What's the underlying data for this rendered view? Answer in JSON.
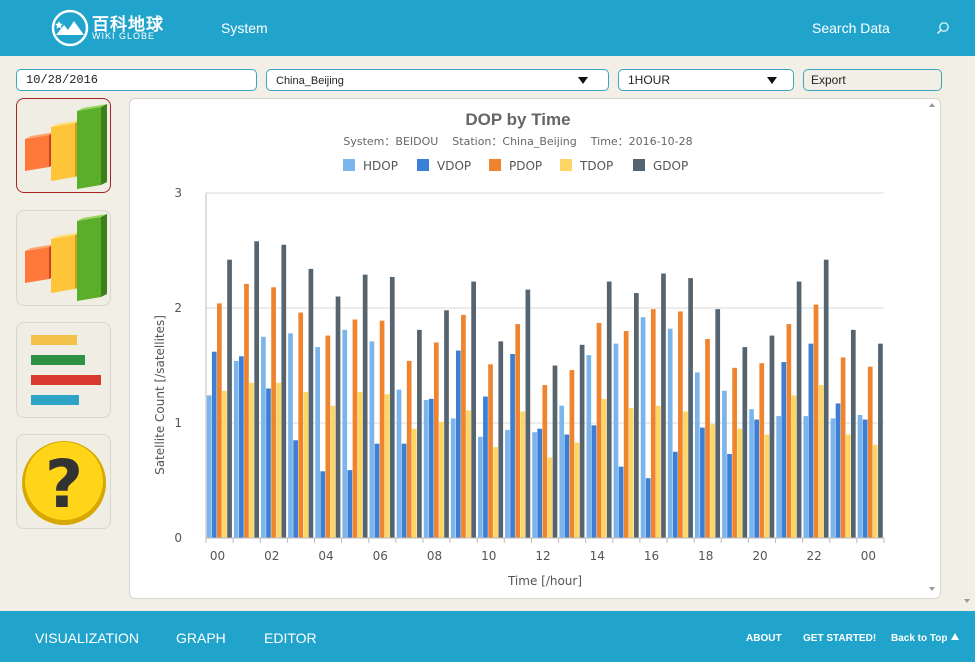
{
  "header": {
    "brand_cn": "百科地球",
    "brand_en": "WIKI GLOBE",
    "nav_system": "System",
    "search_label": "Search Data"
  },
  "controls": {
    "date_value": "10/28/2016",
    "station_value": "China_Beijing",
    "interval_value": "1HOUR",
    "export_label": "Export"
  },
  "footer": {
    "nav": [
      "VISUALIZATION",
      "GRAPH",
      "EDITOR"
    ],
    "about": "ABOUT",
    "get_started": "GET STARTED!",
    "back_to_top": "Back to Top"
  },
  "colors": {
    "header_bg": "#21a4cc",
    "HDOP": "#7cb5ec",
    "VDOP": "#3b7fd6",
    "PDOP": "#f0832e",
    "TDOP": "#fdd666",
    "GDOP": "#566470"
  },
  "chart_data": {
    "type": "bar",
    "title": "DOP by Time",
    "subtitle": "System：BEIDOU    Station：China_Beijing    Time：2016-10-28",
    "xlabel": "Time [/hour]",
    "ylabel": "Satellite Count [/satellites]",
    "ylim": [
      0,
      3
    ],
    "yticks": [
      "0",
      "1",
      "2",
      "3"
    ],
    "xticks": [
      "00",
      "02",
      "04",
      "06",
      "08",
      "10",
      "12",
      "14",
      "16",
      "18",
      "20",
      "22",
      "00"
    ],
    "grid": true,
    "legend_position": "top",
    "categories": [
      "00",
      "01",
      "02",
      "03",
      "04",
      "05",
      "06",
      "07",
      "08",
      "09",
      "10",
      "11",
      "12",
      "13",
      "14",
      "15",
      "16",
      "17",
      "18",
      "19",
      "20",
      "21",
      "22",
      "23",
      "00"
    ],
    "series": [
      {
        "name": "HDOP",
        "values": [
          1.24,
          1.54,
          1.75,
          1.78,
          1.66,
          1.81,
          1.71,
          1.29,
          1.2,
          1.04,
          0.88,
          0.94,
          0.92,
          1.15,
          1.59,
          1.69,
          1.92,
          1.82,
          1.44,
          1.28,
          1.12,
          1.06,
          1.06,
          1.04,
          1.07
        ]
      },
      {
        "name": "VDOP",
        "values": [
          1.62,
          1.58,
          1.3,
          0.85,
          0.58,
          0.59,
          0.82,
          0.82,
          1.21,
          1.63,
          1.23,
          1.6,
          0.95,
          0.9,
          0.98,
          0.62,
          0.52,
          0.75,
          0.96,
          0.73,
          1.03,
          1.53,
          1.69,
          1.17,
          1.03
        ]
      },
      {
        "name": "PDOP",
        "values": [
          2.04,
          2.21,
          2.18,
          1.96,
          1.76,
          1.9,
          1.89,
          1.54,
          1.7,
          1.94,
          1.51,
          1.86,
          1.33,
          1.46,
          1.87,
          1.8,
          1.99,
          1.97,
          1.73,
          1.48,
          1.52,
          1.86,
          2.03,
          1.57,
          1.49
        ]
      },
      {
        "name": "TDOP",
        "values": [
          1.28,
          1.35,
          1.35,
          1.27,
          1.15,
          1.27,
          1.25,
          0.95,
          1.01,
          1.11,
          0.79,
          1.1,
          0.7,
          0.83,
          1.21,
          1.13,
          1.15,
          1.1,
          0.99,
          0.95,
          0.9,
          1.24,
          1.33,
          0.9,
          0.81
        ]
      },
      {
        "name": "GDOP",
        "values": [
          2.42,
          2.58,
          2.55,
          2.34,
          2.1,
          2.29,
          2.27,
          1.81,
          1.98,
          2.23,
          1.71,
          2.16,
          1.5,
          1.68,
          2.23,
          2.13,
          2.3,
          2.26,
          1.99,
          1.66,
          1.76,
          2.23,
          2.42,
          1.81,
          1.69
        ]
      }
    ]
  }
}
